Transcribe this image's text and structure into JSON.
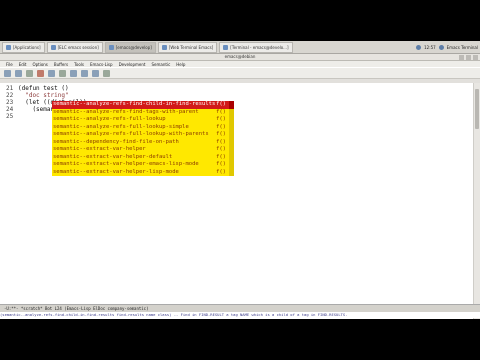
{
  "taskbar": {
    "tasks": [
      "[Applications]",
      "[ELC emacs session]",
      "[emacs@develop]",
      "[Web Terminal Emacs]",
      "[Terminal - emacs@develo...]"
    ],
    "tray": [
      "12:57",
      "Emacs Terminal"
    ]
  },
  "window": {
    "title": "emacs@debian"
  },
  "menu": [
    "File",
    "Edit",
    "Options",
    "Buffers",
    "Tools",
    "Emacs-Lisp",
    "Development",
    "Semantic",
    "Help"
  ],
  "editor": {
    "lines": [
      {
        "num": "21",
        "text": "(defun test ()"
      },
      {
        "num": "22",
        "text": "  \"doc string\""
      },
      {
        "num": "23",
        "text": "  (let ((dict nil))"
      },
      {
        "num": "24",
        "text": "    (semantic"
      },
      {
        "num": "25",
        "text": ""
      }
    ]
  },
  "completion": {
    "items": [
      {
        "label": "semantic--analyze-refs-find-child-in-find-results",
        "annotation": "f()"
      },
      {
        "label": "semantic--analyze-refs-find-tags-with-parent",
        "annotation": "f()"
      },
      {
        "label": "semantic--analyze-refs-full-lookup",
        "annotation": "f()"
      },
      {
        "label": "semantic--analyze-refs-full-lookup-simple",
        "annotation": "f()"
      },
      {
        "label": "semantic--analyze-refs-full-lookup-with-parents",
        "annotation": "f()"
      },
      {
        "label": "semantic--dependency-find-file-on-path",
        "annotation": "f()"
      },
      {
        "label": "semantic--extract-var-helper",
        "annotation": "f()"
      },
      {
        "label": "semantic--extract-var-helper-default",
        "annotation": "f()"
      },
      {
        "label": "semantic--extract-var-helper-emacs-lisp-mode",
        "annotation": "f()"
      },
      {
        "label": "semantic--extract-var-helper-lisp-mode",
        "annotation": "f()"
      }
    ]
  },
  "modeline": {
    "text": "-U:**-  *scratch*   Bot L24   (Emacs-Lisp ElDoc company-semantic)"
  },
  "minibuffer": {
    "text": "(semantic--analyze-refs-find-child-in-find-results find-results name class) -- Find in FIND-RESULT a tag NAME which is a child of a tag in FIND-RESULTS."
  }
}
